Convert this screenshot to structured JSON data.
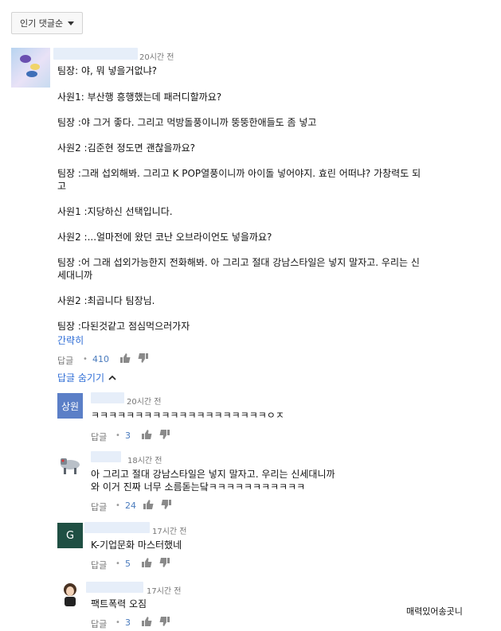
{
  "sort": {
    "label": "인기 댓글순"
  },
  "main_comment": {
    "time": "20시간 전",
    "lines": [
      "팀장: 야, 뭐 넣을거없냐?",
      "사원1: 부산행 흥행했는데 패러디할까요?",
      "팀장 :야 그거 좋다. 그리고 먹방돌풍이니까 뚱뚱한애들도 좀 넣고",
      "사원2 :김준현 정도면 괜찮을까요?",
      "팀장 :그래 섭외해봐. 그리고 K POP열풍이니까 아이돌 넣어야지. 효린 어떠냐? 가창력도 되",
      "고",
      "사원1 :지당하신 선택입니다.",
      "사원2 :...얼마전에 왔던 코난 오브라이언도 넣을까요?",
      "팀장 :어 그래 섭외가능한지 전화해봐. 아 그리고 절대 강남스타일은 넣지 말자고. 우리는 신",
      "세대니까",
      "사원2 :최곱니다 팀장님.",
      "팀장 :다된것같고 점심먹으러가자"
    ],
    "collapse_label": "간략히",
    "reply_label": "답글",
    "dot": "•",
    "likes": "410",
    "hide_replies_label": "답글 숨기기"
  },
  "replies": [
    {
      "avatar_text": "상원",
      "time": "20시간 전",
      "lines": [
        "ㅋㅋㅋㅋㅋㅋㅋㅋㅋㅋㅋㅋㅋㅋㅋㅋㅋㅋㅋㅋㅇㅈ"
      ],
      "reply_label": "답글",
      "dot": "•",
      "likes": "3"
    },
    {
      "avatar_icon": "robot-dog-avatar",
      "time": "18시간 전",
      "lines": [
        "아 그리고 절대 강남스타일은 넣지 말자고. 우리는 신세대니까",
        "와 이거 진짜 너무 소름돋는닼ㅋㅋㅋㅋㅋㅋㅋㅋㅋㅋㅋ"
      ],
      "reply_label": "답글",
      "dot": "•",
      "likes": "24"
    },
    {
      "avatar_text": "G",
      "time": "17시간 전",
      "lines": [
        "K-기업문화 마스터했네"
      ],
      "reply_label": "답글",
      "dot": "•",
      "likes": "5"
    },
    {
      "avatar_icon": "girl-avatar",
      "time": "17시간 전",
      "lines": [
        "팩트폭력 오짐"
      ],
      "reply_label": "답글",
      "dot": "•",
      "likes": "3"
    }
  ],
  "watermark": "매력있어송곳니",
  "colors": {
    "link_blue": "#2e6dd6",
    "likes_blue": "#4a7bbd",
    "redaction": "#e6eef9"
  }
}
